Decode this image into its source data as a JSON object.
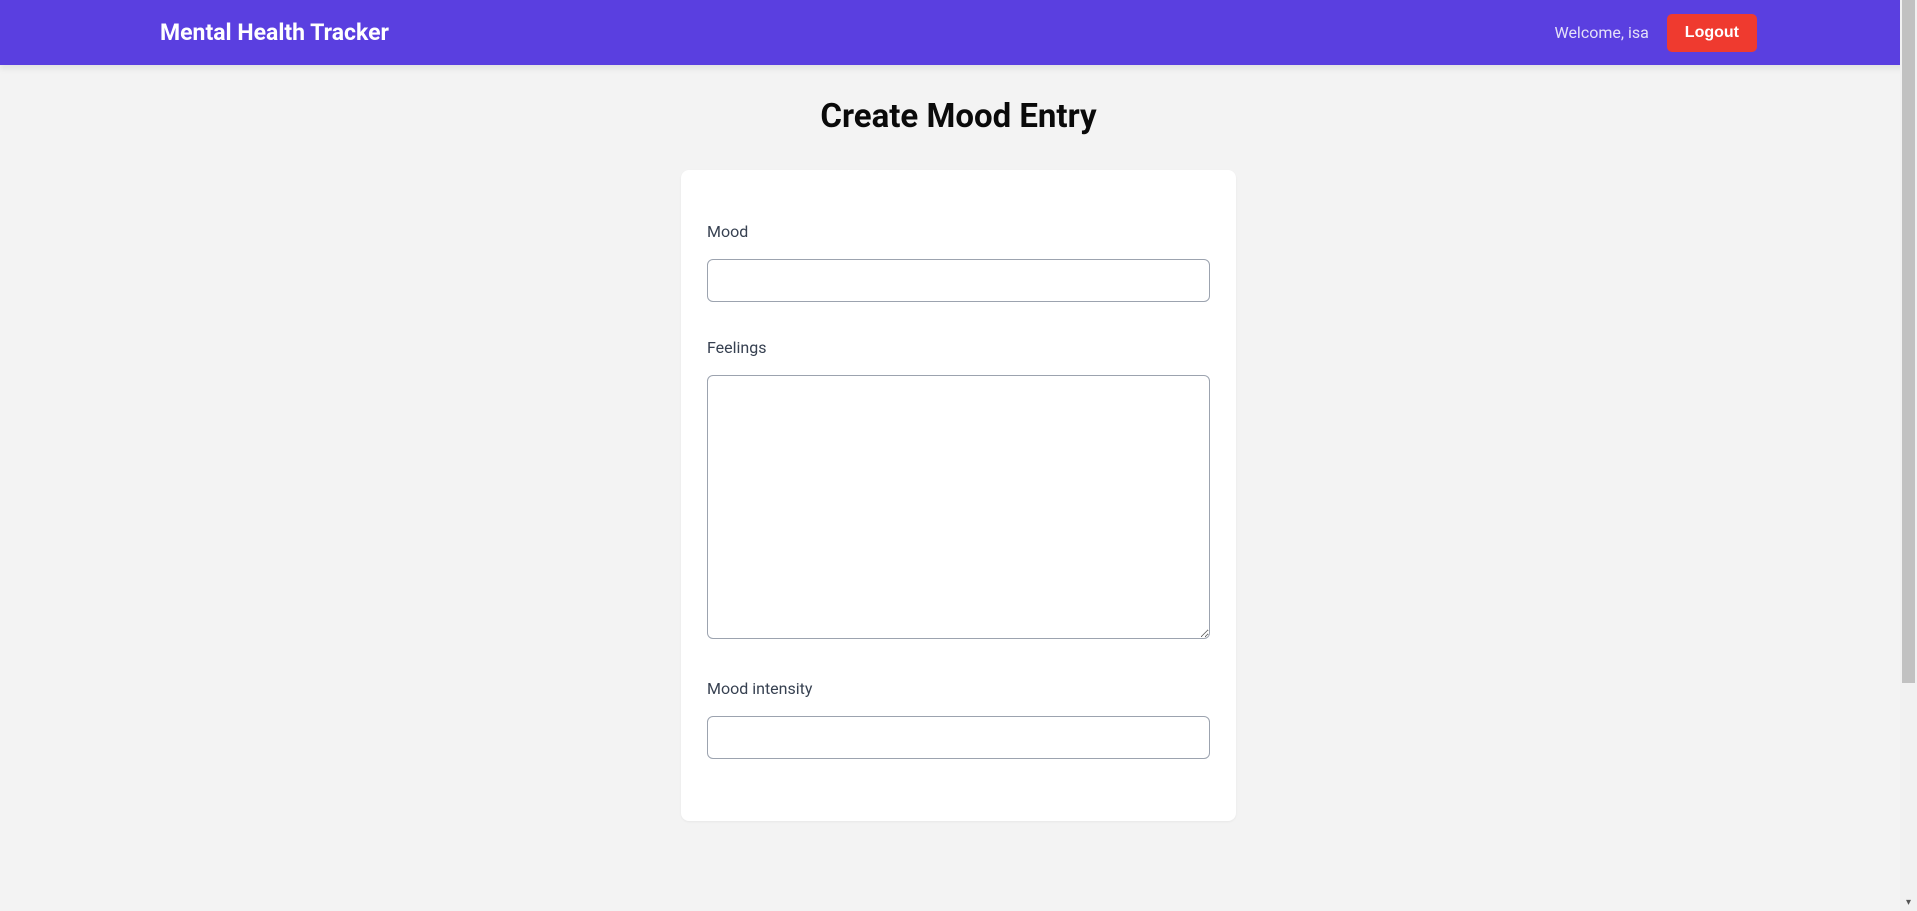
{
  "header": {
    "app_title": "Mental Health Tracker",
    "welcome_text": "Welcome, isa",
    "logout_label": "Logout"
  },
  "page": {
    "title": "Create Mood Entry"
  },
  "form": {
    "mood": {
      "label": "Mood",
      "value": ""
    },
    "feelings": {
      "label": "Feelings",
      "value": ""
    },
    "mood_intensity": {
      "label": "Mood intensity",
      "value": ""
    }
  }
}
